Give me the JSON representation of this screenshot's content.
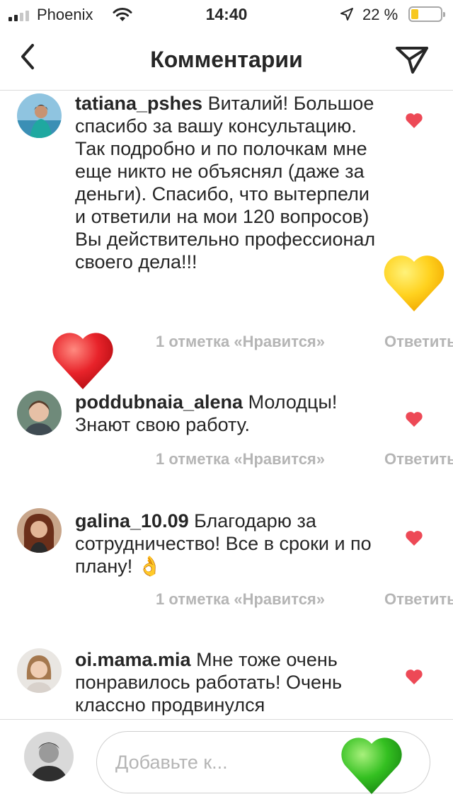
{
  "status_bar": {
    "carrier": "Phoenix",
    "time": "14:40",
    "battery_percent": "22 %",
    "battery_level": 0.22
  },
  "nav": {
    "title": "Комментарии",
    "back_icon": "chevron-left-icon",
    "send_icon": "paper-plane-icon"
  },
  "comments": [
    {
      "username": "tatiana_pshes",
      "text": "Виталий! Большое спасибо за вашу консультацию. Так подробно и по полочкам мне еще никто не объяснял (даже за деньги). Спасибо, что вытерпели и ответили на мои 120 вопросов) Вы действительно профессионал своего дела!!!",
      "likes": "1 отметка «Нравится»",
      "reply": "Ответить"
    },
    {
      "username": "poddubnaia_alena",
      "text": "Молодцы! Знают свою работу.",
      "likes": "1 отметка «Нравится»",
      "reply": "Ответить"
    },
    {
      "username": "galina_10.09",
      "text": "Благодарю за сотрудничество! Все в сроки и по плану! 👌",
      "likes": "1 отметка «Нравится»",
      "reply": "Ответить"
    },
    {
      "username": "oi.mama.mia",
      "text": "Мне тоже очень понравилось работать! Очень классно продвинулся",
      "likes": "",
      "reply": ""
    }
  ],
  "composer": {
    "placeholder": "Добавьте к..."
  },
  "colors": {
    "like_red": "#ed4956",
    "meta_gray": "#b5b5b5",
    "text": "#262626",
    "heart_yellow": "#ffd21f",
    "heart_red": "#e8232a",
    "heart_green": "#34c021"
  }
}
